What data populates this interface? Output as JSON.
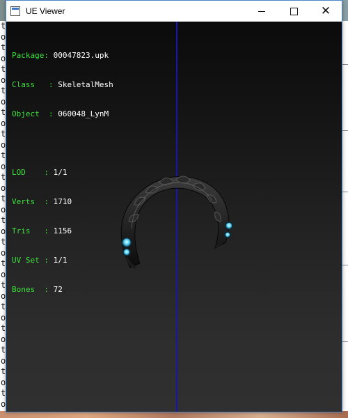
{
  "window": {
    "title": "UE Viewer"
  },
  "info": {
    "group1": [
      {
        "key": "Package: ",
        "value": "00047823.upk"
      },
      {
        "key": "Class   : ",
        "value": "SkeletalMesh"
      },
      {
        "key": "Object  : ",
        "value": "060048_LynM"
      }
    ],
    "group2": [
      {
        "key": "LOD    : ",
        "value": "1/1"
      },
      {
        "key": "Verts  : ",
        "value": "1710"
      },
      {
        "key": "Tris   : ",
        "value": "1156"
      },
      {
        "key": "UV Set : ",
        "value": "1/1"
      },
      {
        "key": "Bones  : ",
        "value": "72"
      }
    ]
  },
  "background_left_chars": [
    "t",
    "o",
    "t",
    "o",
    "t",
    "o",
    "t",
    "o",
    "t",
    "o",
    "t",
    "o",
    "t",
    "o",
    "t",
    "o",
    "t",
    "o",
    "t",
    "o",
    "t",
    "o",
    "t",
    "o",
    "t",
    "o",
    "t",
    "o",
    "t",
    "o",
    "t",
    "o",
    "t",
    "o",
    "t",
    "o"
  ],
  "colors": {
    "info_key": "#3de03d",
    "info_value": "#ffffff",
    "axis_line": "#1414b8",
    "gem": "#5fd8ff"
  }
}
